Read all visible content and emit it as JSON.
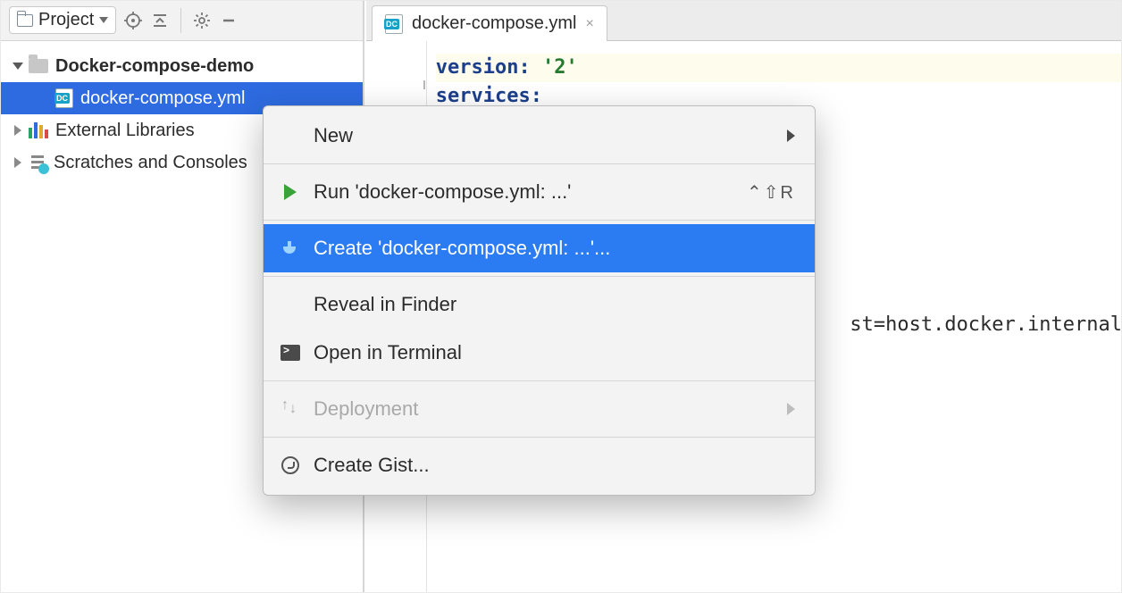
{
  "sidebar": {
    "title": "Project",
    "tree": {
      "root": "Docker-compose-demo",
      "file": "docker-compose.yml",
      "ext_libs": "External Libraries",
      "scratches": "Scratches and Consoles"
    }
  },
  "editor": {
    "tab_name": "docker-compose.yml",
    "code": {
      "line1_key": "version",
      "line1_val": "'2'",
      "line2_key": "services",
      "line3_partial": "st=host.docker.internal"
    }
  },
  "context_menu": {
    "new": "New",
    "run": "Run 'docker-compose.yml: ...'",
    "run_shortcut": "⌃⇧R",
    "create": "Create 'docker-compose.yml: ...'...",
    "reveal": "Reveal in Finder",
    "open_terminal": "Open in Terminal",
    "deployment": "Deployment",
    "gist": "Create Gist..."
  }
}
